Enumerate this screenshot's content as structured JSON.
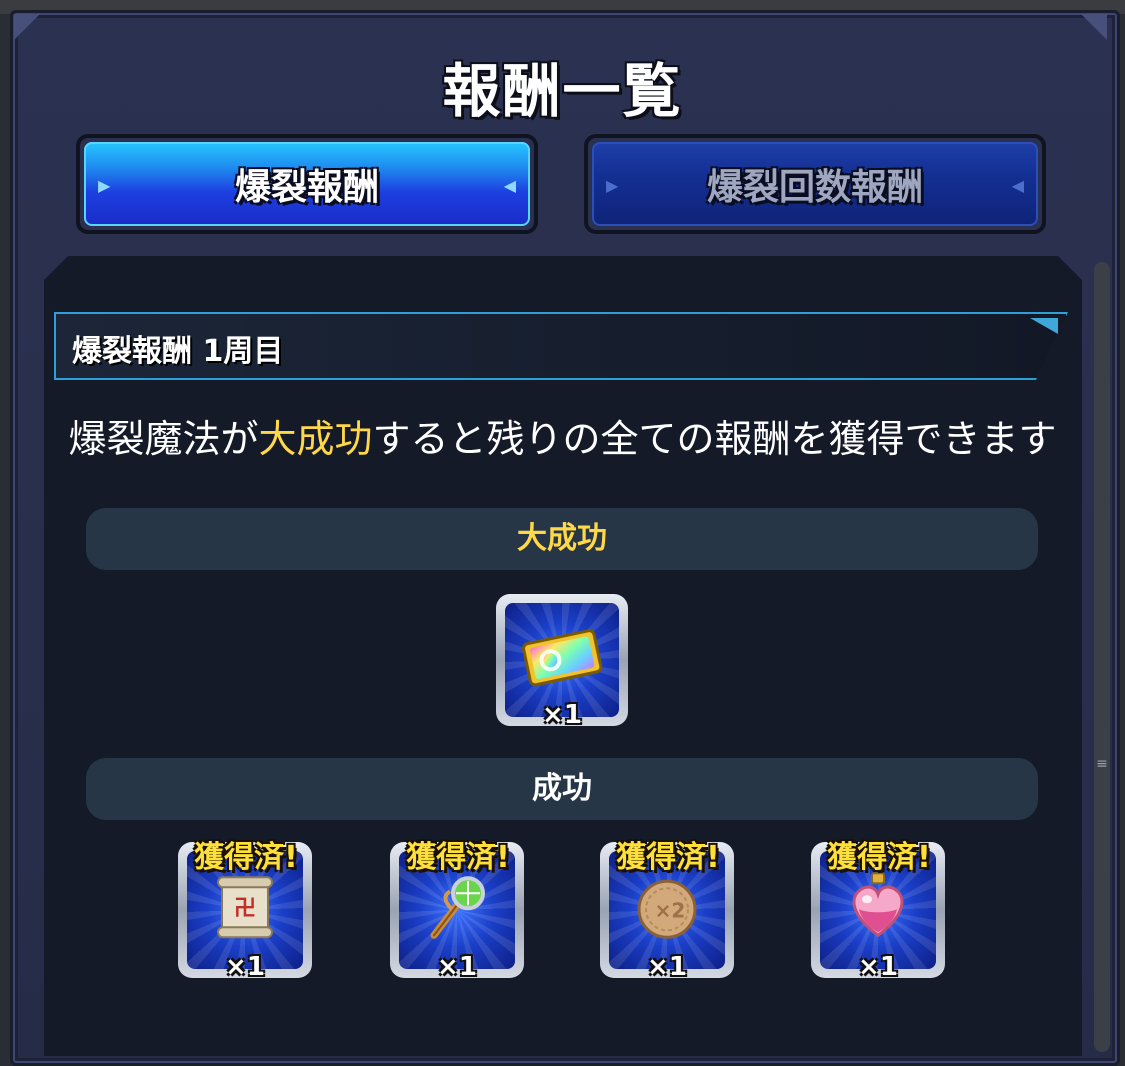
{
  "title": "報酬一覧",
  "tabs": [
    {
      "label": "爆裂報酬",
      "active": true
    },
    {
      "label": "爆裂回数報酬",
      "active": false
    }
  ],
  "section": {
    "title": "爆裂報酬 1周目",
    "description_prefix": "爆裂魔法が",
    "description_highlight": "大成功",
    "description_suffix": "すると残りの全ての報酬を獲得できます"
  },
  "great_success": {
    "label": "大成功",
    "rewards": [
      {
        "icon": "rainbow-ticket-icon",
        "quantity": "×1"
      }
    ]
  },
  "success": {
    "label": "成功",
    "rewards": [
      {
        "icon": "scroll-icon",
        "quantity": "×1",
        "status": "獲得済!"
      },
      {
        "icon": "magic-staff-icon",
        "quantity": "×1",
        "status": "獲得済!"
      },
      {
        "icon": "cookie-x2-icon",
        "quantity": "×1",
        "status": "獲得済!"
      },
      {
        "icon": "heart-potion-icon",
        "quantity": "×1",
        "status": "獲得済!"
      }
    ]
  },
  "colors": {
    "highlight": "#ffd84a",
    "tab_active": "#1f8cf0",
    "tab_inactive": "#132f93",
    "badge": "#ffe03a"
  }
}
